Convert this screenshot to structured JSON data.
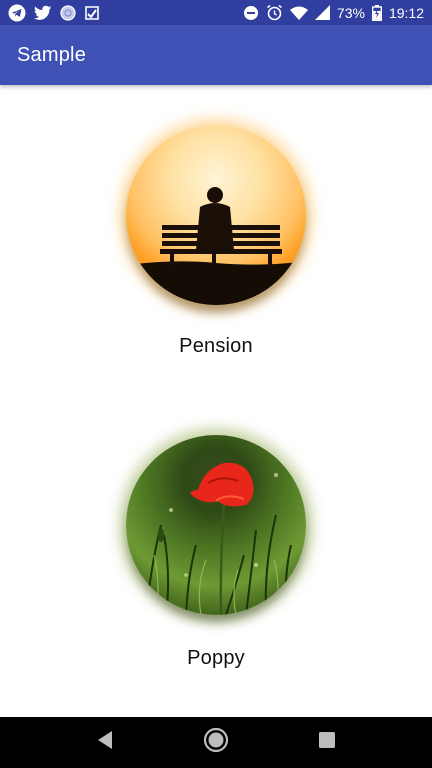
{
  "status_bar": {
    "battery_percent": "73%",
    "time": "19:12",
    "icons": [
      "telegram-icon",
      "twitter-icon",
      "browser-icon",
      "notification-icon",
      "do-not-disturb-icon",
      "alarm-icon",
      "wifi-icon",
      "signal-icon",
      "battery-icon"
    ]
  },
  "app_bar": {
    "title": "Sample"
  },
  "cards": [
    {
      "label": "Pension",
      "image": "bench-sunset-image"
    },
    {
      "label": "Poppy",
      "image": "red-poppy-image"
    }
  ],
  "nav_bar": {
    "buttons": [
      "back-icon",
      "home-icon",
      "recents-icon"
    ]
  },
  "colors": {
    "status_bar": "#303f9f",
    "app_bar": "#3f51b5",
    "nav_bar": "#000000"
  }
}
